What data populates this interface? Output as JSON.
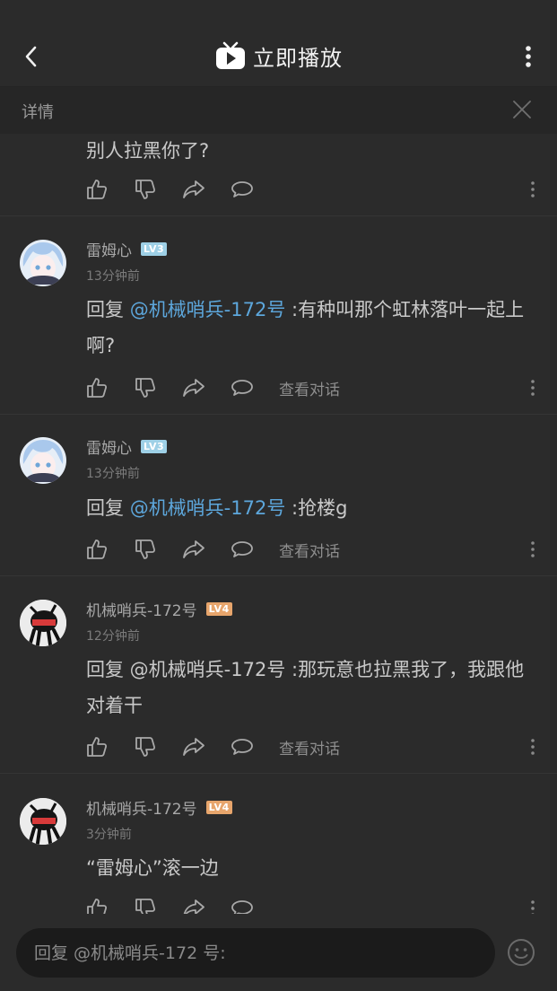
{
  "header": {
    "title": "立即播放"
  },
  "detail_bar": {
    "label": "详情"
  },
  "partial_comment": {
    "text": "别人拉黑你了?"
  },
  "comments": [
    {
      "username": "雷姆心",
      "level": "LV3",
      "time": "13分钟前",
      "reply_prefix": "回复",
      "mention": "@机械哨兵-172号",
      "body": ":有种叫那个虹林落叶一起上啊?",
      "view_conversation": "查看对话"
    },
    {
      "username": "雷姆心",
      "level": "LV3",
      "time": "13分钟前",
      "reply_prefix": "回复",
      "mention": "@机械哨兵-172号",
      "body": ":抢楼g",
      "view_conversation": "查看对话"
    },
    {
      "username": "机械哨兵-172号",
      "level": "LV4",
      "time": "12分钟前",
      "text": "回复 @机械哨兵-172号 :那玩意也拉黑我了，我跟他对着干",
      "view_conversation": "查看对话"
    },
    {
      "username": "机械哨兵-172号",
      "level": "LV4",
      "time": "3分钟前",
      "text": "“雷姆心”滚一边"
    }
  ],
  "reply_input": {
    "placeholder": "回复 @机械哨兵-172 号:"
  },
  "icons": {
    "back": "chevron-left-icon",
    "tv": "tv-play-icon",
    "more": "more-vertical-icon",
    "close": "close-icon",
    "like": "thumbs-up-icon",
    "dislike": "thumbs-down-icon",
    "share": "share-icon",
    "reply": "comment-icon",
    "emoji": "emoji-icon"
  },
  "colors": {
    "background": "#2b2b2b",
    "mention": "#5da7dc",
    "lv3_badge": "#9ed0e6",
    "lv4_badge": "#e7a56c"
  }
}
